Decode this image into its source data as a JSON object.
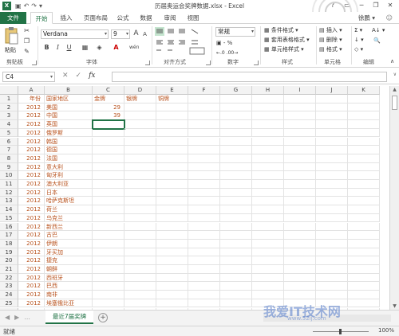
{
  "title_bar": {
    "app_icon": "X",
    "qat_icons": [
      "save-icon",
      "undo-icon",
      "redo-icon",
      "customize-icon"
    ],
    "qat_glyphs": [
      "▣",
      "↶",
      "↷",
      "▾"
    ],
    "document_title": "历届奥运会奖牌数据.xlsx - Excel",
    "window_buttons": [
      "?",
      "▭",
      "─",
      "❐",
      "✕"
    ]
  },
  "tabs": {
    "file": "文件",
    "items": [
      "开始",
      "插入",
      "页面布局",
      "公式",
      "数据",
      "审阅",
      "视图"
    ],
    "active": "开始",
    "user": "徐鹏 ▾",
    "help": "☺"
  },
  "ribbon": {
    "clipboard": {
      "paste_label": "粘贴",
      "group_label": "剪贴板"
    },
    "font": {
      "font_name": "Verdana",
      "font_size": "9",
      "bold": "B",
      "italic": "I",
      "underline": "U",
      "group_label": "字体",
      "grow": "A",
      "shrink": "A",
      "phonetic": "wén"
    },
    "alignment": {
      "group_label": "对齐方式"
    },
    "number": {
      "format": "常规",
      "percent": "%",
      "comma": ",",
      "group_label": "数字",
      "currency": "▣ - %",
      "dec": "←.0 .00→"
    },
    "styles": {
      "conditional": "条件格式 ▾",
      "table": "套用表格格式 ▾",
      "cell": "单元格样式 ▾",
      "group_label": "样式"
    },
    "cells": {
      "insert": "插入 ▾",
      "delete": "删除 ▾",
      "format": "格式 ▾",
      "group_label": "单元格"
    },
    "editing": {
      "group_label": "编辑",
      "sum": "Σ ▾",
      "fill": "↓ ▾",
      "clear": "◇ ▾",
      "sort": "A↓ ▾",
      "find": "🔍"
    }
  },
  "formula_bar": {
    "name_box": "C4",
    "cancel": "✕",
    "enter": "✓",
    "fx": "fx",
    "formula": ""
  },
  "grid": {
    "columns": [
      "A",
      "B",
      "C",
      "D",
      "E",
      "F",
      "G",
      "H",
      "I",
      "J",
      "K"
    ],
    "rows": [
      [
        "年份",
        "国家地区",
        "金牌",
        "银牌",
        "铜牌"
      ],
      [
        "2012",
        "美国",
        "29",
        "",
        ""
      ],
      [
        "2012",
        "中国",
        "39",
        "",
        ""
      ],
      [
        "2012",
        "英国",
        "",
        "",
        ""
      ],
      [
        "2012",
        "俄罗斯",
        "",
        "",
        ""
      ],
      [
        "2012",
        "韩国",
        "",
        "",
        ""
      ],
      [
        "2012",
        "德国",
        "",
        "",
        ""
      ],
      [
        "2012",
        "法国",
        "",
        "",
        ""
      ],
      [
        "2012",
        "意大利",
        "",
        "",
        ""
      ],
      [
        "2012",
        "匈牙利",
        "",
        "",
        ""
      ],
      [
        "2012",
        "澳大利亚",
        "",
        "",
        ""
      ],
      [
        "2012",
        "日本",
        "",
        "",
        ""
      ],
      [
        "2012",
        "哈萨克斯坦",
        "",
        "",
        ""
      ],
      [
        "2012",
        "荷兰",
        "",
        "",
        ""
      ],
      [
        "2012",
        "乌克兰",
        "",
        "",
        ""
      ],
      [
        "2012",
        "新西兰",
        "",
        "",
        ""
      ],
      [
        "2012",
        "古巴",
        "",
        "",
        ""
      ],
      [
        "2012",
        "伊朗",
        "",
        "",
        ""
      ],
      [
        "2012",
        "牙买加",
        "",
        "",
        ""
      ],
      [
        "2012",
        "捷克",
        "",
        "",
        ""
      ],
      [
        "2012",
        "朝鲜",
        "",
        "",
        ""
      ],
      [
        "2012",
        "西班牙",
        "",
        "",
        ""
      ],
      [
        "2012",
        "巴西",
        "",
        "",
        ""
      ],
      [
        "2012",
        "南非",
        "",
        "",
        ""
      ],
      [
        "2012",
        "埃塞俄比亚",
        "",
        "",
        ""
      ],
      [
        "2012",
        "",
        "",
        "",
        ""
      ]
    ],
    "row_numbers": [
      "1",
      "2",
      "3",
      "4",
      "5",
      "6",
      "7",
      "8",
      "9",
      "10",
      "11",
      "12",
      "13",
      "14",
      "15",
      "16",
      "17",
      "18",
      "19",
      "20",
      "21",
      "22",
      "23",
      "24",
      "25",
      "26"
    ]
  },
  "sheets": {
    "nav": [
      "◀",
      "▶",
      "..."
    ],
    "active_sheet": "最近7届奖牌",
    "add": "+"
  },
  "status_bar": {
    "status": "就绪",
    "zoom": "100%",
    "zoom_controls": "─      +"
  },
  "watermark": {
    "main": "我爱IT技术网",
    "sub": "www.52ij.com"
  },
  "colors": {
    "excel_green": "#217346",
    "cell_text": "#b8521d"
  }
}
